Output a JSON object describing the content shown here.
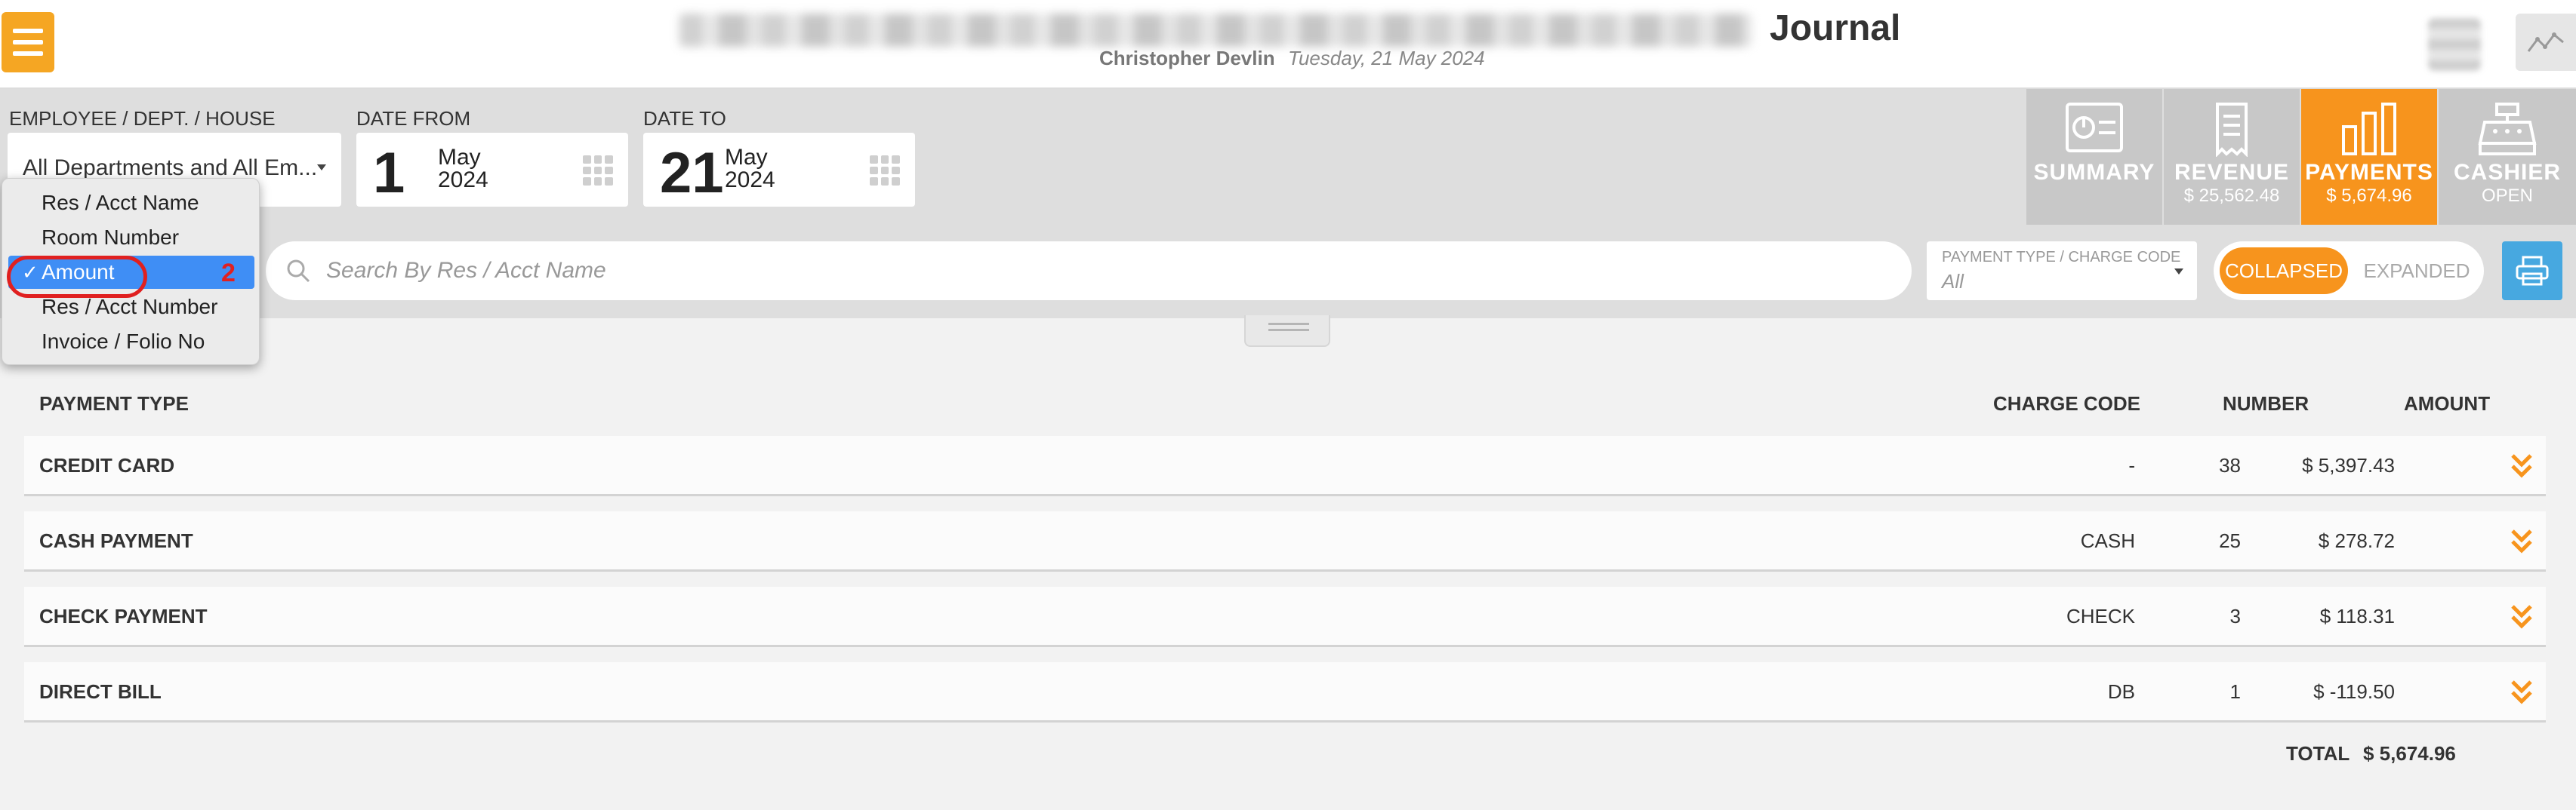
{
  "header": {
    "title": "Journal",
    "user": "Christopher Devlin",
    "date": "Tuesday, 21 May 2024"
  },
  "filters": {
    "dept_label": "EMPLOYEE / DEPT. / HOUSE",
    "dept_value": "All Departments and All Em...",
    "date_from_label": "DATE FROM",
    "date_from": {
      "day": "1",
      "month": "May",
      "year": "2024"
    },
    "date_to_label": "DATE TO",
    "date_to": {
      "day": "21",
      "month": "May",
      "year": "2024"
    }
  },
  "tabs": [
    {
      "label": "SUMMARY",
      "value": "",
      "active": false
    },
    {
      "label": "REVENUE",
      "value": "$ 25,562.48",
      "active": false
    },
    {
      "label": "PAYMENTS",
      "value": "$ 5,674.96",
      "active": true
    },
    {
      "label": "CASHIER",
      "value": "OPEN",
      "active": false
    }
  ],
  "search": {
    "placeholder": "Search By Res / Acct Name",
    "payment_type_label": "PAYMENT TYPE / CHARGE CODE",
    "payment_type_value": "All",
    "toggle_on": "COLLAPSED",
    "toggle_off": "EXPANDED"
  },
  "dropdown": {
    "items": [
      "Res / Acct Name",
      "Room Number",
      "Amount",
      "Res / Acct Number",
      "Invoice / Folio No"
    ],
    "selected_index": 2,
    "check": "✓",
    "marker": "2"
  },
  "table": {
    "headers": {
      "type": "PAYMENT TYPE",
      "code": "CHARGE CODE",
      "number": "NUMBER",
      "amount": "AMOUNT"
    },
    "rows": [
      {
        "type": "CREDIT CARD",
        "code": "-",
        "number": "38",
        "amount": "$ 5,397.43"
      },
      {
        "type": "CASH PAYMENT",
        "code": "CASH",
        "number": "25",
        "amount": "$ 278.72"
      },
      {
        "type": "CHECK PAYMENT",
        "code": "CHECK",
        "number": "3",
        "amount": "$ 118.31"
      },
      {
        "type": "DIRECT BILL",
        "code": "DB",
        "number": "1",
        "amount": "$ -119.50"
      }
    ],
    "total_label": "TOTAL",
    "total_value": "$ 5,674.96"
  },
  "colors": {
    "accent": "#f7941d",
    "menu": "#f5a623",
    "selected": "#3f8ef5",
    "highlight": "#e02020",
    "print": "#47a8e0"
  }
}
